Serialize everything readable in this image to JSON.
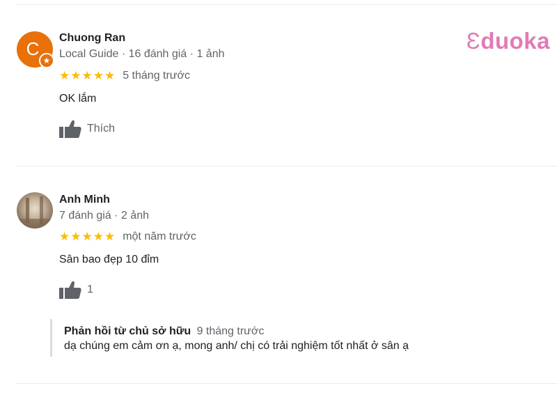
{
  "logo": {
    "mark": "Ɛ",
    "text": "duoka"
  },
  "reviews": [
    {
      "avatar_letter": "C",
      "name": "Chuong Ran",
      "meta": "Local Guide · 16 đánh giá · 1 ảnh",
      "rating": 5,
      "stars": "★★★★★",
      "time_ago": "5 tháng trước",
      "text": "OK lắm",
      "like_label": "Thích"
    },
    {
      "name": "Anh Minh",
      "meta": "7 đánh giá · 2 ảnh",
      "rating": 5,
      "stars": "★★★★★",
      "time_ago": "một năm trước",
      "text": "Sân bao đẹp 10 đỉm",
      "like_label": "1",
      "owner_reply": {
        "title": "Phản hồi từ chủ sở hữu",
        "time_ago": "9 tháng trước",
        "text": "dạ chúng em cảm ơn ạ, mong anh/ chị có trải nghiệm tốt nhất ở sân ạ"
      }
    }
  ],
  "colors": {
    "star": "#fbbc04",
    "avatar_bg": "#e8710a",
    "logo": "#e07bb5"
  }
}
